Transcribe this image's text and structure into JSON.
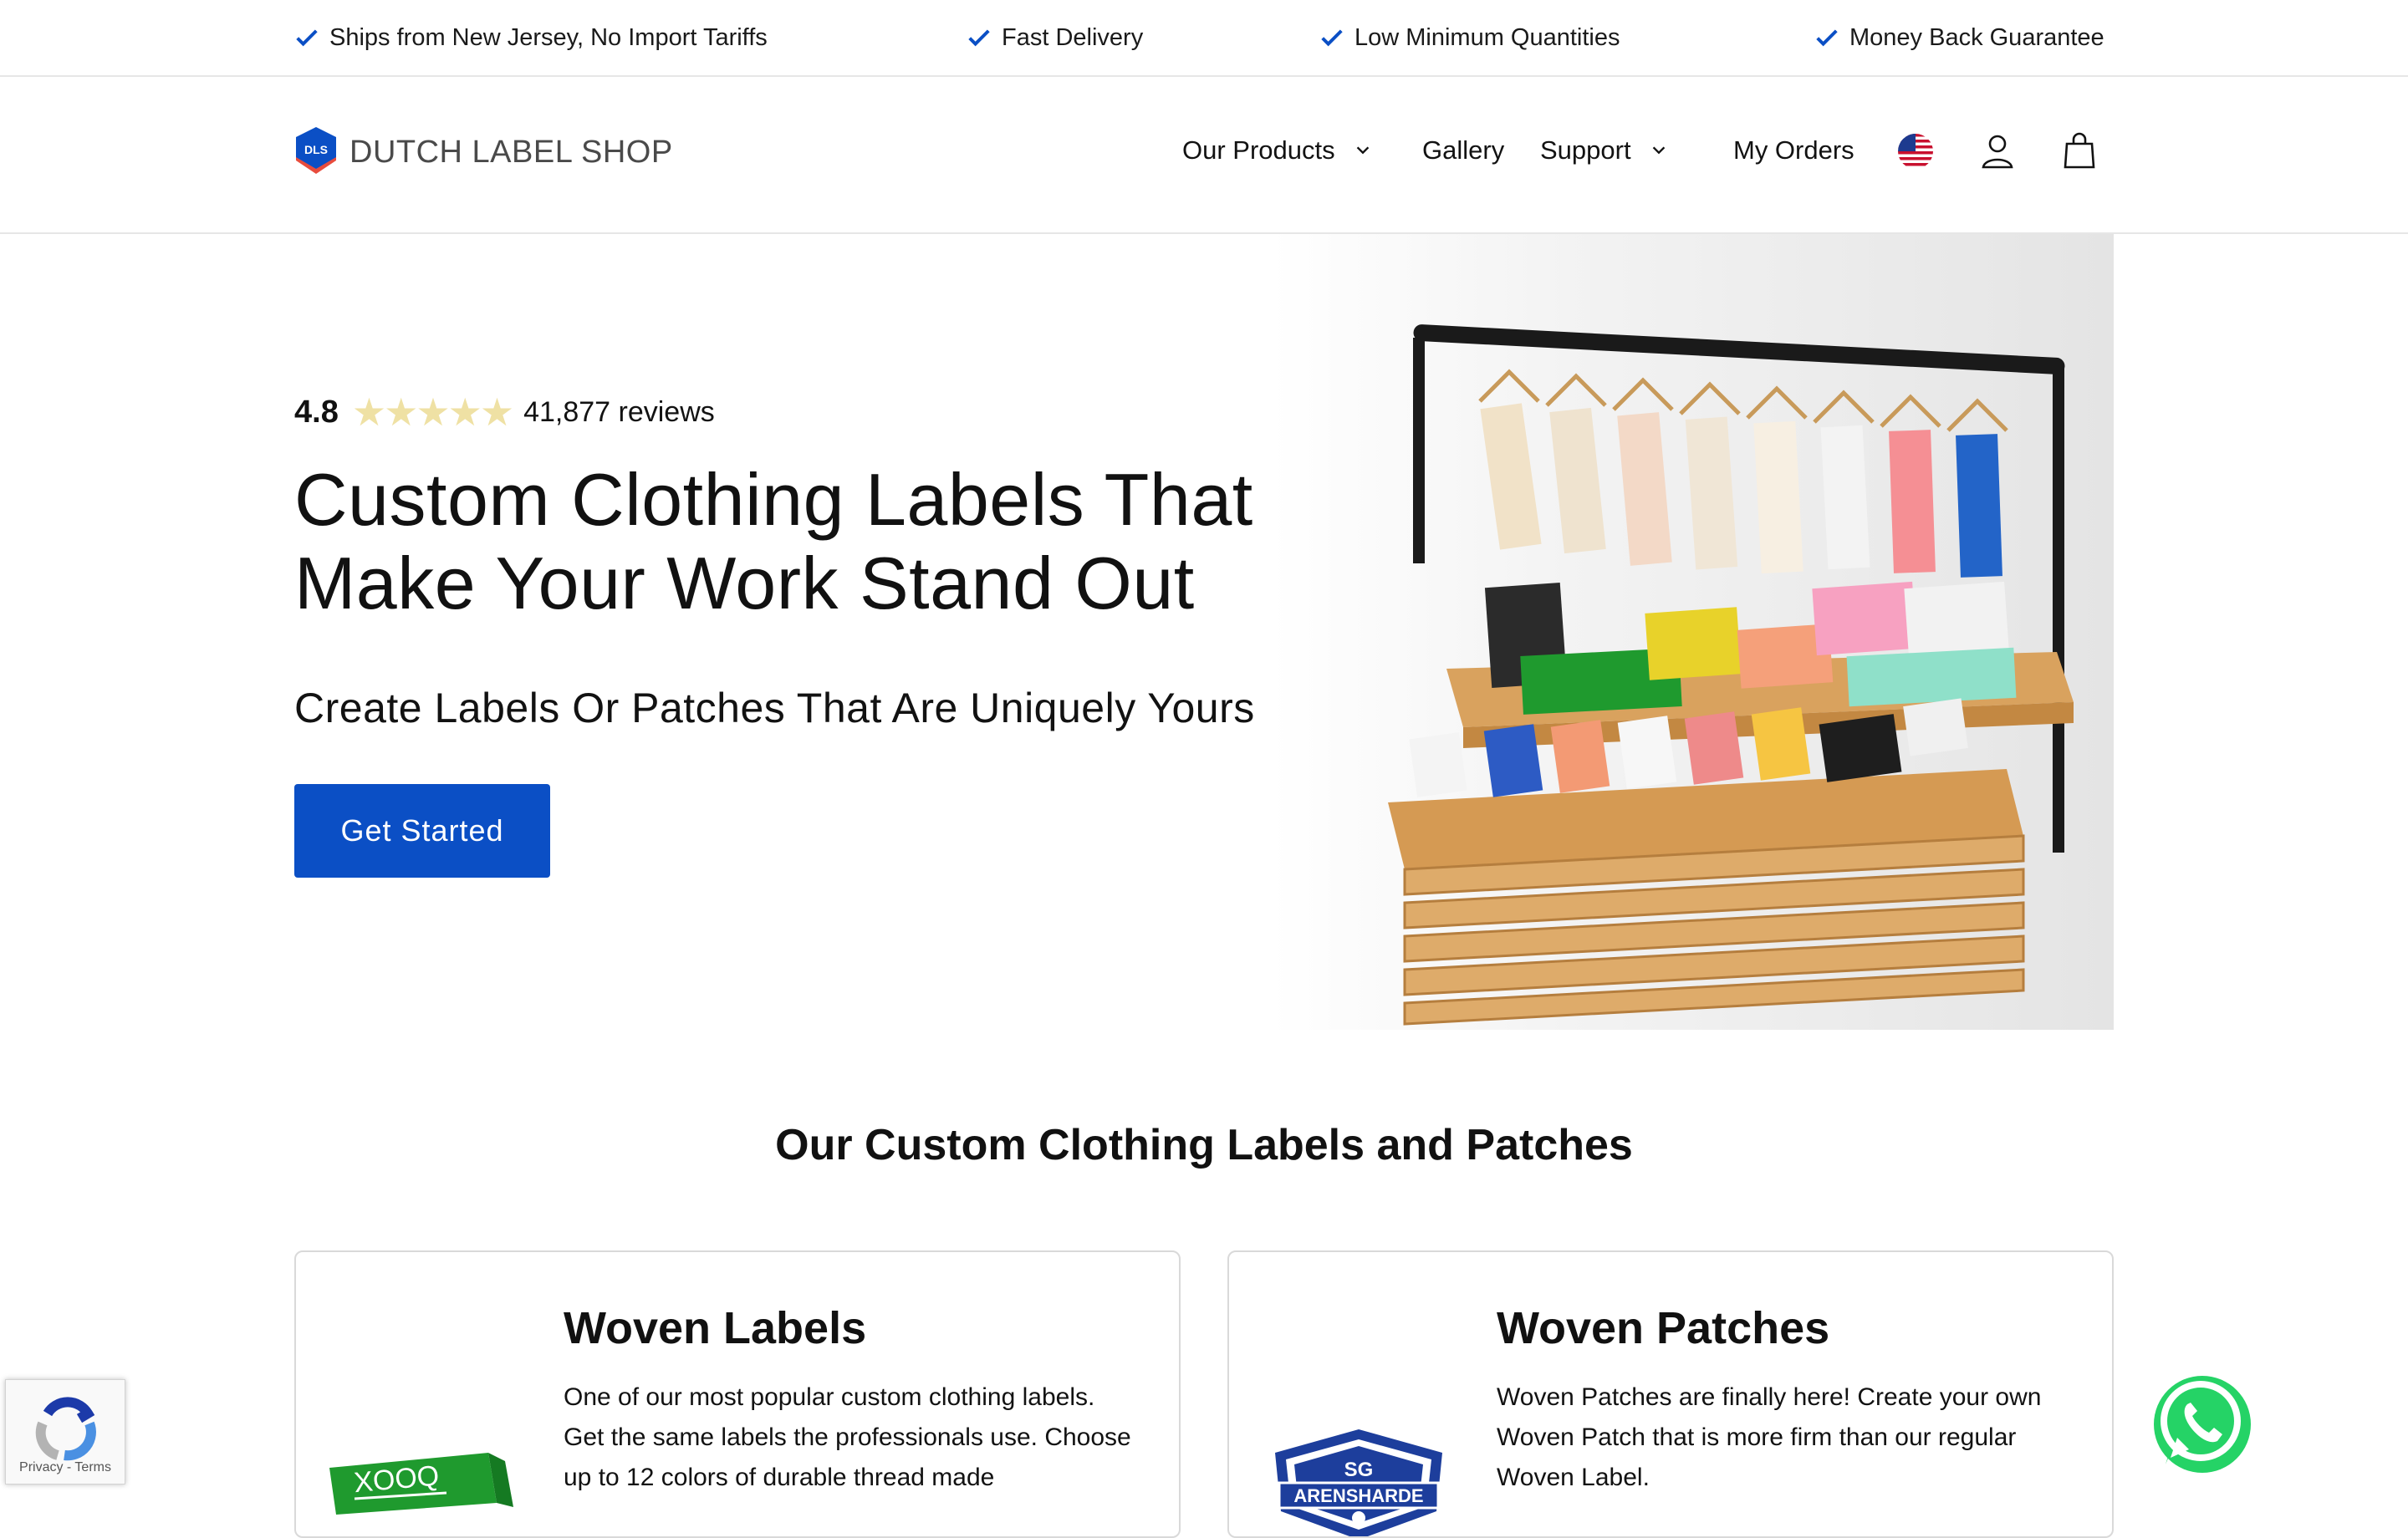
{
  "announcements": [
    {
      "icon": "check-icon",
      "text": "Ships from New Jersey, No Import Tariffs"
    },
    {
      "icon": "check-icon",
      "text": "Fast Delivery"
    },
    {
      "icon": "check-icon",
      "text": "Low Minimum Quantities"
    },
    {
      "icon": "check-icon",
      "text": "Money Back Guarantee"
    }
  ],
  "header": {
    "logo_badge": "DLS",
    "logo_text": "DUTCH LABEL SHOP",
    "nav": [
      {
        "label": "Our Products",
        "has_dropdown": true
      },
      {
        "label": "Gallery",
        "has_dropdown": false
      },
      {
        "label": "Support",
        "has_dropdown": true
      },
      {
        "label": "My Orders",
        "has_dropdown": false
      }
    ],
    "icons": [
      "us-flag-icon",
      "account-icon",
      "cart-icon"
    ]
  },
  "hero": {
    "rating_score": "4.8",
    "rating_stars": 5,
    "reviews": "41,877 reviews",
    "title": "Custom Clothing Labels That Make Your Work Stand Out",
    "subtitle": "Create Labels Or Patches That Are Uniquely Yours",
    "cta_label": "Get Started"
  },
  "products_section": {
    "title": "Our Custom Clothing Labels and Patches",
    "cards": [
      {
        "title": "Woven Labels",
        "description": "One of our most popular custom clothing labels. Get the same labels the professionals use. Choose up to 12 colors of durable thread made",
        "thumb_text": "XOOQ"
      },
      {
        "title": "Woven Patches",
        "description": "Woven Patches are finally here! Create your own Woven Patch that is more firm than our regular Woven Label.",
        "thumb_text_top": "SG",
        "thumb_text_main": "ARENSHARDE"
      }
    ]
  },
  "recaptcha": {
    "links": "Privacy - Terms"
  },
  "colors": {
    "brand_blue": "#0b4fc5",
    "star": "#efe1a4",
    "whatsapp_green": "#25d366",
    "woven_green": "#1f9a2e"
  }
}
